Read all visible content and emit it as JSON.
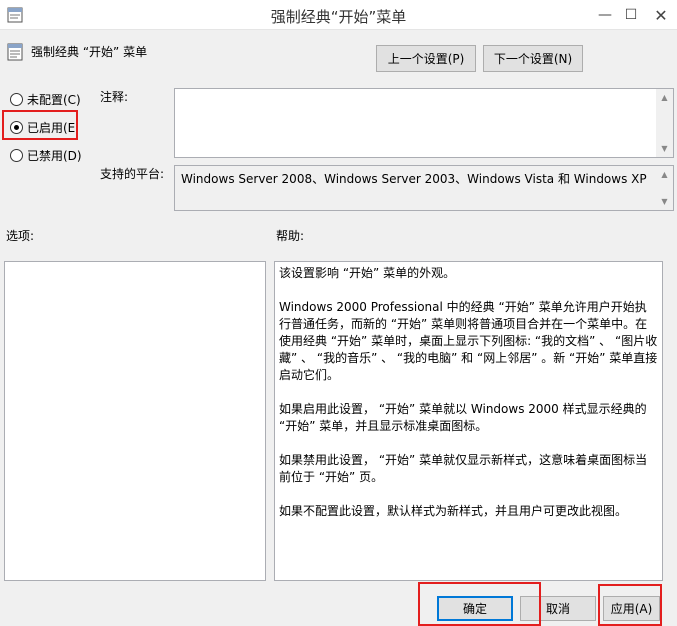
{
  "window": {
    "title": "强制经典“开始”菜单",
    "minimize_glyph": "—",
    "maximize_glyph": "☐",
    "close_glyph": "✕"
  },
  "header": {
    "policy_name": "强制经典 “开始” 菜单",
    "prev_setting": "上一个设置(P)",
    "next_setting": "下一个设置(N)"
  },
  "state_options": [
    {
      "label": "未配置(C)",
      "selected": false
    },
    {
      "label": "已启用(E",
      "selected": true
    },
    {
      "label": "已禁用(D)",
      "selected": false
    }
  ],
  "comment": {
    "label": "注释:",
    "value": ""
  },
  "platform": {
    "label": "支持的平台:",
    "value": "Windows Server 2008、Windows Server 2003、Windows Vista 和 Windows XP"
  },
  "options": {
    "label": "选项:"
  },
  "help": {
    "label": "帮助:",
    "paragraphs": [
      "该设置影响 “开始” 菜单的外观。",
      "Windows 2000 Professional 中的经典 “开始” 菜单允许用户开始执行普通任务，而新的 “开始” 菜单则将普通项目合并在一个菜单中。在使用经典 “开始” 菜单时，桌面上显示下列图标: “我的文档” 、 “图片收藏” 、 “我的音乐” 、 “我的电脑” 和 “网上邻居” 。新 “开始” 菜单直接启动它们。",
      "如果启用此设置， “开始” 菜单就以 Windows 2000 样式显示经典的 “开始” 菜单，并且显示标准桌面图标。",
      "如果禁用此设置， “开始” 菜单就仅显示新样式，这意味着桌面图标当前位于 “开始” 页。",
      "如果不配置此设置，默认样式为新样式，并且用户可更改此视图。"
    ]
  },
  "footer": {
    "ok": "确定",
    "cancel": "取消",
    "apply": "应用(A)"
  },
  "colors": {
    "highlight": "#e31e1e",
    "default_button_border": "#0078d7"
  }
}
